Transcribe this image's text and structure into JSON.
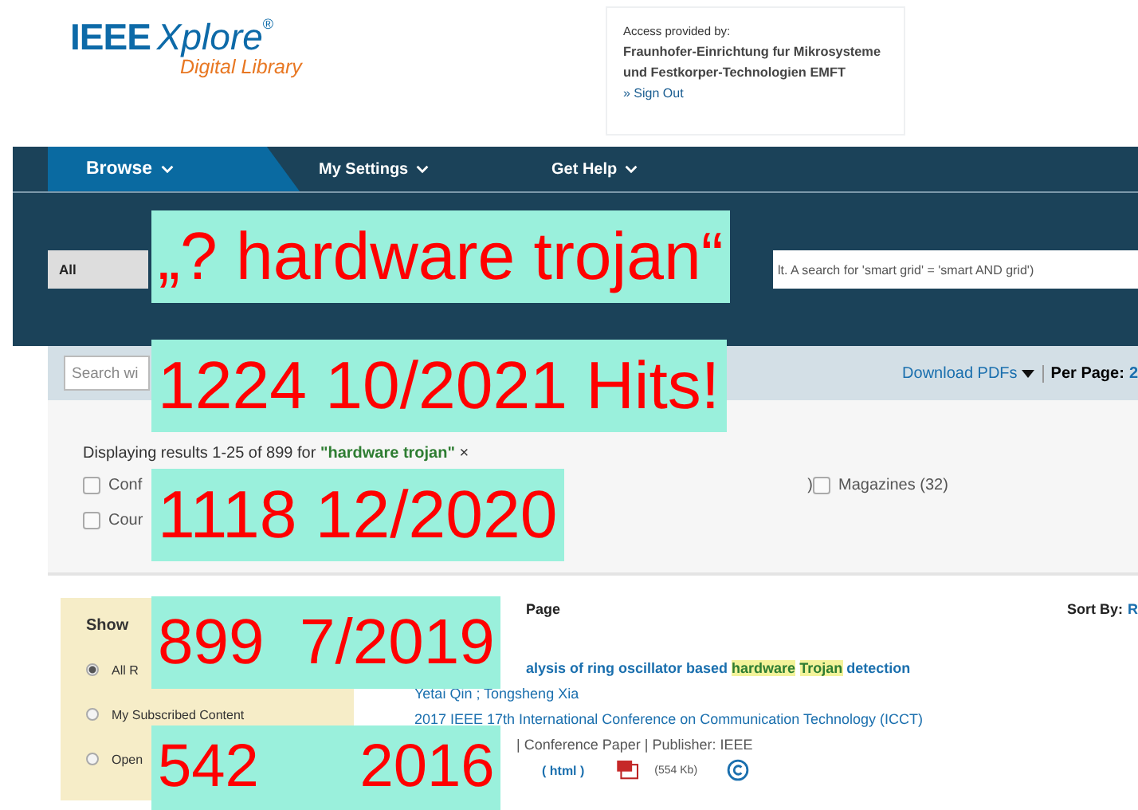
{
  "logo": {
    "brand": "IEEE",
    "product": "Xplore",
    "mark": "®",
    "subtitle": "Digital Library"
  },
  "access": {
    "label": "Access provided by:",
    "institution": "Fraunhofer-Einrichtung fur Mikrosysteme und Festkorper-Technologien EMFT",
    "link": "» Sign Out"
  },
  "nav": [
    {
      "label": "Browse",
      "selected": true
    },
    {
      "label": "My Settings",
      "selected": false
    },
    {
      "label": "Get Help",
      "selected": false
    }
  ],
  "search": {
    "scope": "All",
    "placeholder": "lt. A search for 'smart grid' = 'smart AND grid')"
  },
  "toolbar": {
    "search_within_placeholder": "Search wi",
    "download": "Download PDFs",
    "per_page_label": "Per Page:",
    "per_page_value": "2"
  },
  "results_info": "Displaying results 1-25 of 899 for **\"hardware trojan\"** ×",
  "filters": [
    {
      "label": "Conf",
      "checked": false
    },
    {
      "label": "Magazines (32)",
      "checked": false
    },
    {
      "label": "Cour",
      "checked": false
    }
  ],
  "filter_fragment": ")",
  "show_panel": {
    "title": "Show",
    "options": [
      {
        "label": "All R",
        "selected": true
      },
      {
        "label": "My Subscribed Content",
        "selected": false
      },
      {
        "label": "Open",
        "selected": false
      }
    ]
  },
  "list_header": {
    "label": "Page",
    "sort_label": "Sort By:",
    "sort_value": "R"
  },
  "result": {
    "title": "alysis of ring oscillator based **hardware** **Trojan** detection",
    "authors": "Yetai Qin ; Tongsheng Xia",
    "venue": "2017 IEEE 17th International Conference on Communication Technology (ICCT)",
    "meta": "| Conference Paper | Publisher: IEEE",
    "html": "( html )",
    "pdf_size": "(554 Kb)"
  },
  "annotations": [
    {
      "text": "„? hardware trojan“"
    },
    {
      "text": "1224 10/2021 Hits!"
    },
    {
      "text": "1118 12/2020"
    },
    {
      "text": "899  7/2019"
    },
    {
      "text": "542      2016"
    }
  ]
}
